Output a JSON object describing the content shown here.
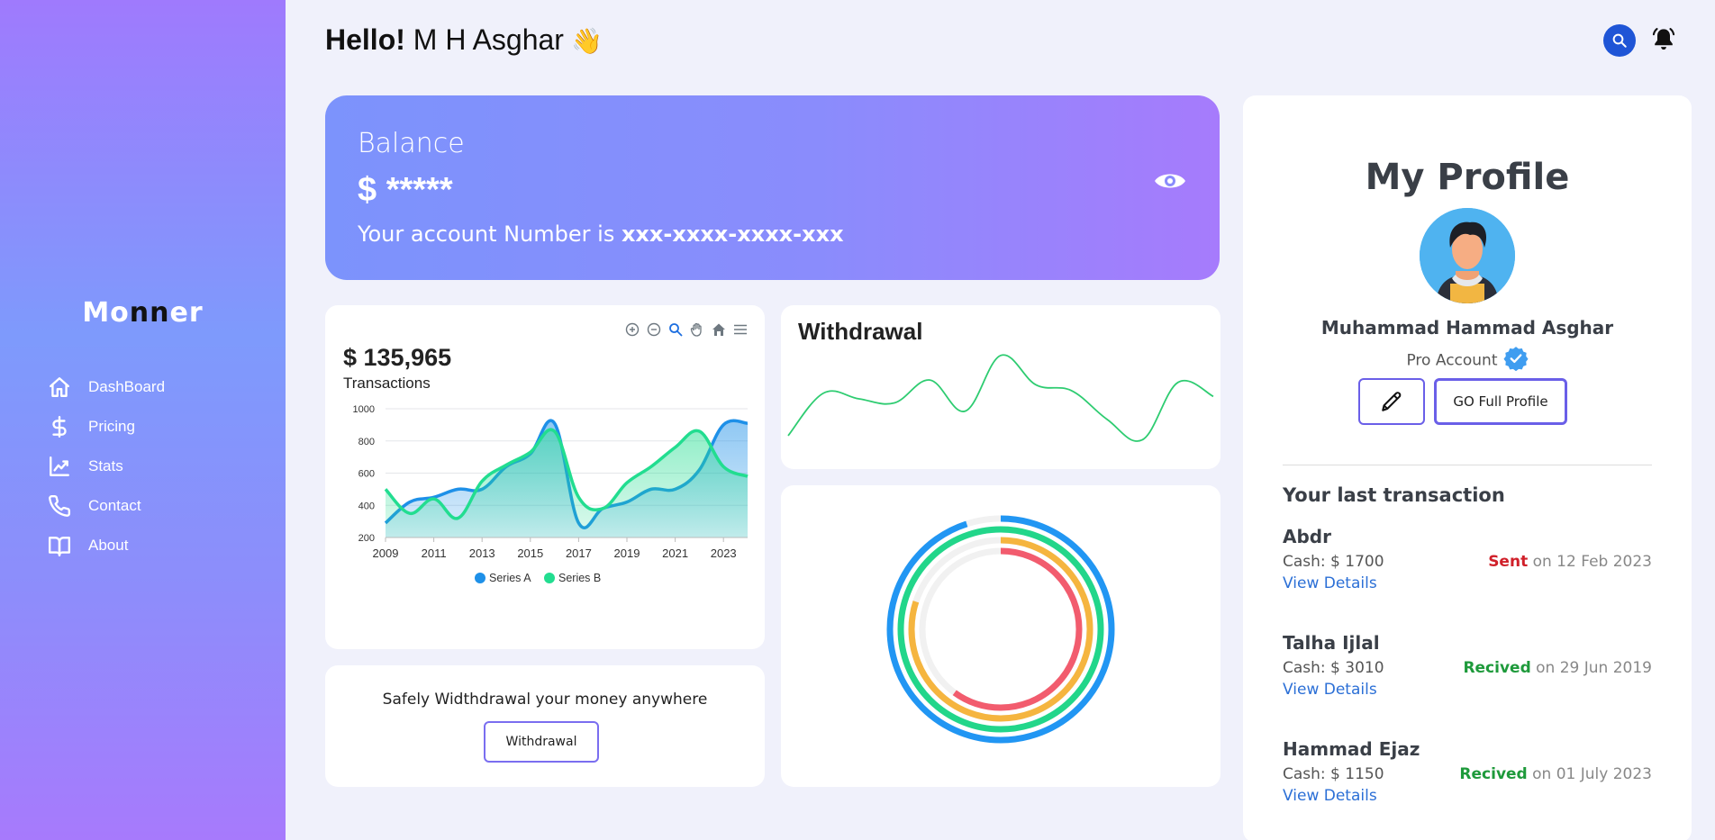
{
  "sidebar": {
    "logo": {
      "part1": "Mo",
      "part2": "nn",
      "part3": "er"
    },
    "items": [
      {
        "label": "DashBoard",
        "icon": "home-icon"
      },
      {
        "label": "Pricing",
        "icon": "dollar-icon"
      },
      {
        "label": "Stats",
        "icon": "chart-line-icon"
      },
      {
        "label": "Contact",
        "icon": "phone-icon"
      },
      {
        "label": "About",
        "icon": "book-icon"
      }
    ]
  },
  "header": {
    "hello": "Hello!",
    "name": " M H Asghar",
    "emoji": "👋"
  },
  "balance": {
    "label": "Balance",
    "amount": "$ *****",
    "account_prefix": "Your account Number is ",
    "account_number": "xxx-xxxx-xxxx-xxx"
  },
  "transactions": {
    "amount": "$ 135,965",
    "label": "Transactions"
  },
  "withdraw_promo": {
    "text": "Safely Widthdrawal your money anywhere",
    "button": "Withdrawal"
  },
  "sparkline": {
    "title": "Withdrawal"
  },
  "profile": {
    "title": "My Profile",
    "name": "Muhammad Hammad Asghar",
    "account_type": "Pro Account",
    "full_profile_button": "GO Full Profile",
    "last_transaction_title": "Your last transaction",
    "transactions": [
      {
        "name": "Abdr",
        "cash": "Cash: $ 1700",
        "status": "Sent",
        "status_kind": "sent",
        "date": " on 12 Feb 2023",
        "link": "View Details"
      },
      {
        "name": "Talha Ijlal",
        "cash": "Cash: $ 3010",
        "status": "Recived",
        "status_kind": "recv",
        "date": " on 29 Jun 2019",
        "link": "View Details"
      },
      {
        "name": "Hammad Ejaz",
        "cash": "Cash: $ 1150",
        "status": "Recived",
        "status_kind": "recv",
        "date": " on 01 July 2023",
        "link": "View Details"
      }
    ]
  },
  "colors": {
    "series_a": "#1e90e8",
    "series_b": "#22dd90",
    "radial": [
      "#2196f3",
      "#22d68a",
      "#f5b53f",
      "#f25c6e"
    ]
  },
  "chart_data": [
    {
      "type": "area",
      "title": "",
      "x": [
        2009,
        2010,
        2011,
        2012,
        2013,
        2014,
        2015,
        2016,
        2017,
        2018,
        2019,
        2020,
        2021,
        2022,
        2023,
        2024
      ],
      "xticks": [
        "2009",
        "2011",
        "2013",
        "2015",
        "2017",
        "2019",
        "2021",
        "2023"
      ],
      "yticks": [
        "1000",
        "800",
        "600",
        "400",
        "200"
      ],
      "ylim": [
        200,
        1000
      ],
      "legend": "bottom",
      "series": [
        {
          "name": "Series A",
          "values": [
            290,
            420,
            450,
            500,
            500,
            640,
            720,
            910,
            290,
            380,
            420,
            500,
            500,
            620,
            900,
            910
          ]
        },
        {
          "name": "Series B",
          "values": [
            500,
            350,
            440,
            320,
            550,
            650,
            730,
            860,
            450,
            380,
            540,
            640,
            760,
            860,
            640,
            580
          ]
        }
      ]
    },
    {
      "type": "line",
      "title": "Withdrawal",
      "values": [
        10,
        62,
        55,
        50,
        78,
        40,
        108,
        72,
        65,
        30,
        5,
        75,
        58
      ]
    },
    {
      "type": "radialBar",
      "values": [
        95,
        100,
        80,
        60
      ]
    }
  ]
}
